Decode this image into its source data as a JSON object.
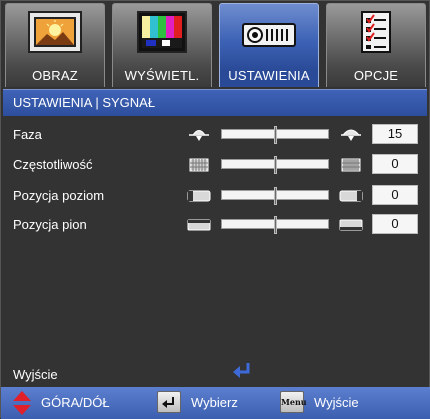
{
  "tabs": [
    {
      "label": "OBRAZ",
      "icon": "picture-icon",
      "active": false
    },
    {
      "label": "WYŚWIETL.",
      "icon": "display-color-bars-icon",
      "active": false
    },
    {
      "label": "USTAWIENIA",
      "icon": "projector-icon",
      "active": true
    },
    {
      "label": "OPCJE",
      "icon": "checklist-icon",
      "active": false
    }
  ],
  "breadcrumb": "USTAWIENIA | SYGNAŁ",
  "rows": [
    {
      "label": "Faza",
      "value": "15",
      "level": 0.5,
      "icon": "phase-icon"
    },
    {
      "label": "Częstotliwość",
      "value": "0",
      "level": 0.5,
      "icon": "frequency-icon"
    },
    {
      "label": "Pozycja poziom",
      "value": "0",
      "level": 0.5,
      "icon": "horizontal-position-icon"
    },
    {
      "label": "Pozycja pion",
      "value": "0",
      "level": 0.5,
      "icon": "vertical-position-icon"
    }
  ],
  "exit_label": "Wyjście",
  "footer": {
    "nav_label": "GÓRA/DÓŁ",
    "select_label": "Wybierz",
    "menu_key": "Menu",
    "exit_label": "Wyjście"
  },
  "colors": {
    "accent": "#2d4e9c",
    "background": "#333333",
    "footer": "#4a6cc0",
    "arrow_red": "#e0202a"
  }
}
